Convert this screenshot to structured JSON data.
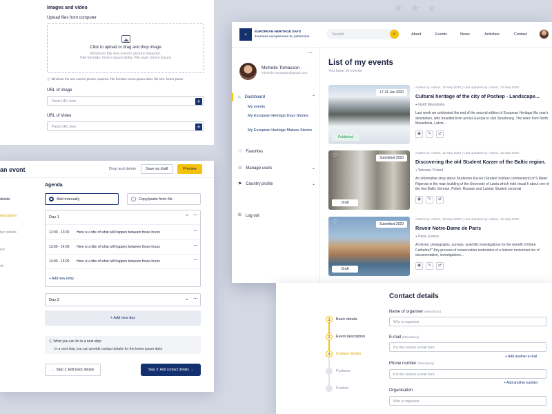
{
  "upload": {
    "title": "Images and video",
    "upload_label": "Upload files from computer",
    "drop_text": "Click to upload or drag and drop image",
    "drop_hint1": "Minimum the one event's picture required.",
    "drop_hint2": "File formats: lorem ipsum dolor. File size: lorem ipsum",
    "info_note": "Minimum the one event's picture required. File formats: lorem ipsum dolor, file size: lorem ipsum",
    "url_image_label": "URL of image",
    "url_image_placeholder": "Paste URL here",
    "url_video_label": "URL of Video",
    "url_video_placeholder": "Paste URL here"
  },
  "agenda_panel": {
    "header_title": "an event",
    "drop_delete": "Drop and delete",
    "save_draft": "Save as draft",
    "preview": "Preview",
    "side_steps": [
      "details",
      "description",
      "tact details",
      "ers",
      "sh"
    ],
    "agenda_title": "Agenda",
    "option_manual": "Add manually",
    "option_copy": "Copy/paste from file",
    "day1": "Day 1",
    "entries": [
      {
        "time": "12:00 - 13:00",
        "text": "Here is a title of what will happen between those hours"
      },
      {
        "time": "13:00 - 14:00",
        "text": "Here is a title of what will happen between those hours"
      },
      {
        "time": "14:00 - 15:00",
        "text": "Here is a title of what will happen between those hours"
      }
    ],
    "add_entry": "Add new entry",
    "day2": "Day 2",
    "add_day": "Add new day",
    "next_title": "What you can do in a next step:",
    "next_text": "In a next step you can provide contact details for the lorem ipsum dolor",
    "back_btn": "Step 1: Edit basic details",
    "next_btn": "Step 3: Add contact details"
  },
  "app": {
    "logo_line1": "EUROPEAN HERITAGE DAYS",
    "logo_line2": "Journées européennes du patrimoine",
    "search_placeholder": "Search",
    "nav": [
      "About",
      "Events",
      "News",
      "Activities",
      "Contact"
    ],
    "user_name": "Michelle Tomasson",
    "user_email": "michelle.tomasson@gmail.com",
    "sidebar": {
      "dashboard": "Dashboard",
      "my_events": "My events",
      "stories1": "My European Heritage Days Stories",
      "stories2": "My European Heritage Makers Stories",
      "favorites": "Favorites",
      "manage_users": "Manage users",
      "country_profile": "Country profile",
      "logout": "Log out"
    },
    "page_title": "List of my events",
    "page_subtitle": "You have 16 events",
    "events": [
      {
        "meta": "Added by: Admin, 12 Sep 2020 | Last updated by: Admin, 12 Sep 2020",
        "title": "Cultural heritage of the city of Pochep - Landscape...",
        "location": "North Macedonia",
        "desc": "Last week we celebrated the end of the second edition of European Heritage Ma year's storytellers, who travelled from across Europe to visit Strasbourg. The selec from North Macedonia, Latvia...",
        "badge": "17-21 Jan 2020",
        "status": "Published"
      },
      {
        "meta": "Added by: Admin, 12 Sep 2020 | Last updated by: Admin, 12 Sep 2020",
        "title": "Discovering the old Student Karzer of the Baltic region.",
        "location": "Warsaw, Poland",
        "desc": "An informative story about Studenten Karzer (Student Solitary confinement) of S Mater Rigensis in the main building of the University of Latvia which hold visual h about one of the first Baltic German, Polish, Russian and Latvian Student corporati",
        "badge": "Submitted 2020",
        "status": "Draft"
      },
      {
        "meta": "Added by: Admin, 12 Sep 2020 | Last updated by: Admin, 12 Sep 2020",
        "title": "Revoir Notre-Dame de Paris",
        "location": "Paris, France",
        "desc": "Archives, photographs, surveys, scientific investigations for the benefit of Notre Cathedral\"\" Any process of conservation-restoration of a historic monument inv of documentation, investigations...",
        "badge": "Submitted 2020",
        "status": "Draft"
      }
    ]
  },
  "contact": {
    "title": "Contact details",
    "steps": [
      {
        "num": "1",
        "name": "Basic details"
      },
      {
        "num": "2",
        "name": "Event description"
      },
      {
        "num": "3",
        "name": "Contact details"
      },
      {
        "num": "",
        "name": "Partners"
      },
      {
        "num": "",
        "name": "Publish"
      }
    ],
    "organiser_label": "Name of organiser",
    "mandatory": "(Mandatory)",
    "organiser_placeholder": "Who is organiser",
    "email_label": "E-mail",
    "email_placeholder": "Put the contact e-mail here",
    "add_email": "Add another e-mail",
    "phone_label": "Phone number",
    "phone_placeholder": "Put the contact e-mail here",
    "add_number": "Add another number",
    "org_label": "Organisation",
    "org_placeholder": "Who is organiser"
  },
  "colors": {
    "accent": "#f4c20d",
    "brand": "#13306f",
    "published": "#1e8f5a"
  }
}
